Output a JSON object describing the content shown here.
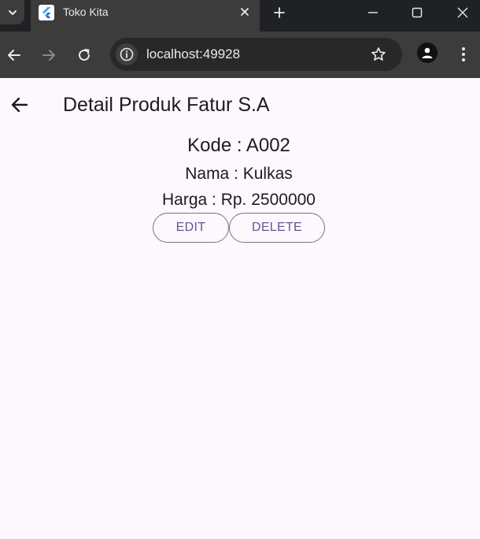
{
  "browser": {
    "tab_title": "Toko Kita",
    "url": "localhost:49928",
    "icons": [
      "tab-search-icon",
      "flutter-logo-icon",
      "close-icon",
      "plus-icon",
      "minimize-icon",
      "maximize-icon",
      "close-window-icon",
      "back-arrow-icon",
      "forward-arrow-icon",
      "reload-icon",
      "info-icon",
      "star-icon",
      "profile-icon",
      "kebab-menu-icon"
    ]
  },
  "app": {
    "title": "Detail Produk Fatur S.A",
    "back_icon": "arrow-back-icon",
    "product": {
      "kode": "Kode : A002",
      "nama": "Nama : Kulkas",
      "harga": "Harga : Rp. 2500000"
    },
    "buttons": {
      "edit": "EDIT",
      "delete": "DELETE"
    }
  },
  "colors": {
    "page_bg": "#fdf7fe",
    "button_text": "#65558f",
    "button_border": "#79747e",
    "chrome_dark": "#202124",
    "chrome_toolbar": "#3c3c3c"
  }
}
